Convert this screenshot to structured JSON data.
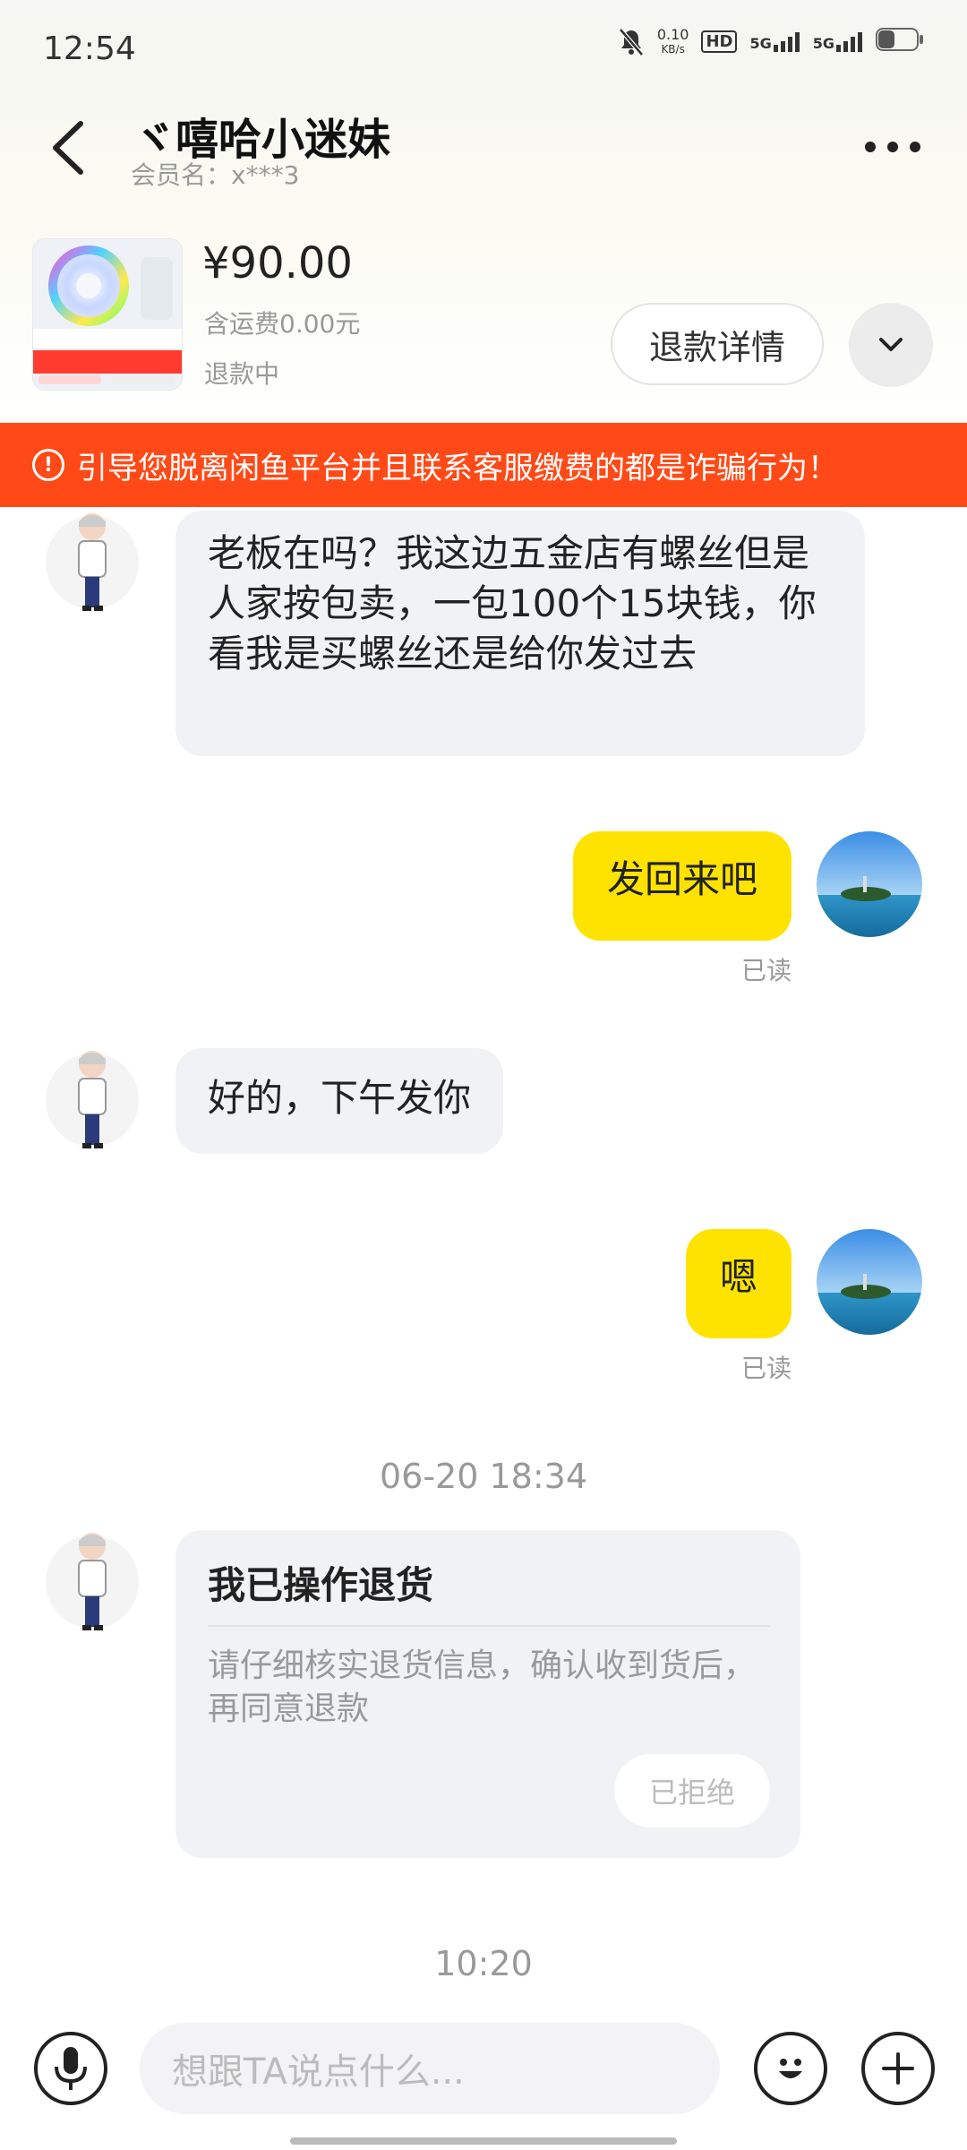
{
  "status": {
    "time": "12:54",
    "net_speed_value": "0.10",
    "net_speed_unit": "KB/s",
    "hd": "HD",
    "signal1": "5G",
    "signal2": "5G"
  },
  "header": {
    "nickname": "ヾ嘻哈小迷妹",
    "member_label": "会员名：x***3"
  },
  "product": {
    "price": "¥90.00",
    "shipping": "含运费0.00元",
    "status": "退款中",
    "refund_button": "退款详情"
  },
  "banner": {
    "icon": "!",
    "text": "引导您脱离闲鱼平台并且联系客服缴费的都是诈骗行为！"
  },
  "messages": [
    {
      "from": "other",
      "text": "老板在吗？我这边五金店有螺丝但是人家按包卖，一包100个15块钱，你看我是买螺丝还是给你发过去"
    },
    {
      "from": "me",
      "text": "发回来吧",
      "status": "已读"
    },
    {
      "from": "other",
      "text": "好的，下午发你"
    },
    {
      "from": "me",
      "text": "嗯",
      "status": "已读"
    }
  ],
  "timestamps": [
    "06-20 18:34",
    "10:20"
  ],
  "return_card": {
    "title": "我已操作退货",
    "description": "请仔细核实退货信息，确认收到货后，再同意退款",
    "button": "已拒绝"
  },
  "input": {
    "placeholder": "想跟TA说点什么..."
  },
  "colors": {
    "accent_yellow": "#ffe300",
    "warning_red": "#ff4a17",
    "bubble_gray": "#f1f2f4"
  }
}
